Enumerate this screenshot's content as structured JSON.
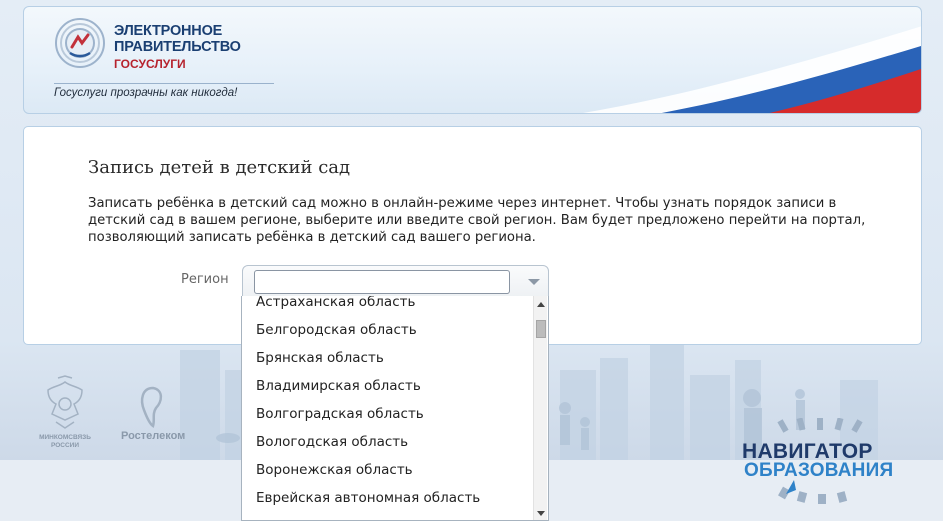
{
  "header": {
    "logo_line1": "ЭЛЕКТРОННОЕ",
    "logo_line2": "ПРАВИТЕЛЬСТВО",
    "logo_line3": "ГОСУСЛУГИ",
    "slogan": "Госуслуги прозрачны как никогда!"
  },
  "main": {
    "title": "Запись детей в детский сад",
    "description": "Записать ребёнка в детский сад можно в онлайн-режиме через интернет. Чтобы узнать порядок записи в детский сад в вашем регионе, выберите или введите свой регион. Вам будет предложено перейти на портал, позволяющий записать ребёнка в детский сад вашего региона.",
    "region_label": "Регион",
    "region_value": ""
  },
  "dropdown": {
    "options": [
      "Астраханская область",
      "Белгородская область",
      "Брянская область",
      "Владимирская область",
      "Волгоградская область",
      "Вологодская область",
      "Воронежская область",
      "Еврейская автономная область"
    ]
  },
  "footer": {
    "ministry_caption": "МИНКОМСВЯЗЬ РОССИИ",
    "rostelecom": "Ростелеком",
    "navigator_line1": "НАВИГАТОР",
    "navigator_line2": "ОБРАЗОВАНИЯ"
  },
  "colors": {
    "brand_blue": "#1a3f72",
    "brand_red": "#b6222d",
    "navigator_light_blue": "#2f82c8"
  }
}
